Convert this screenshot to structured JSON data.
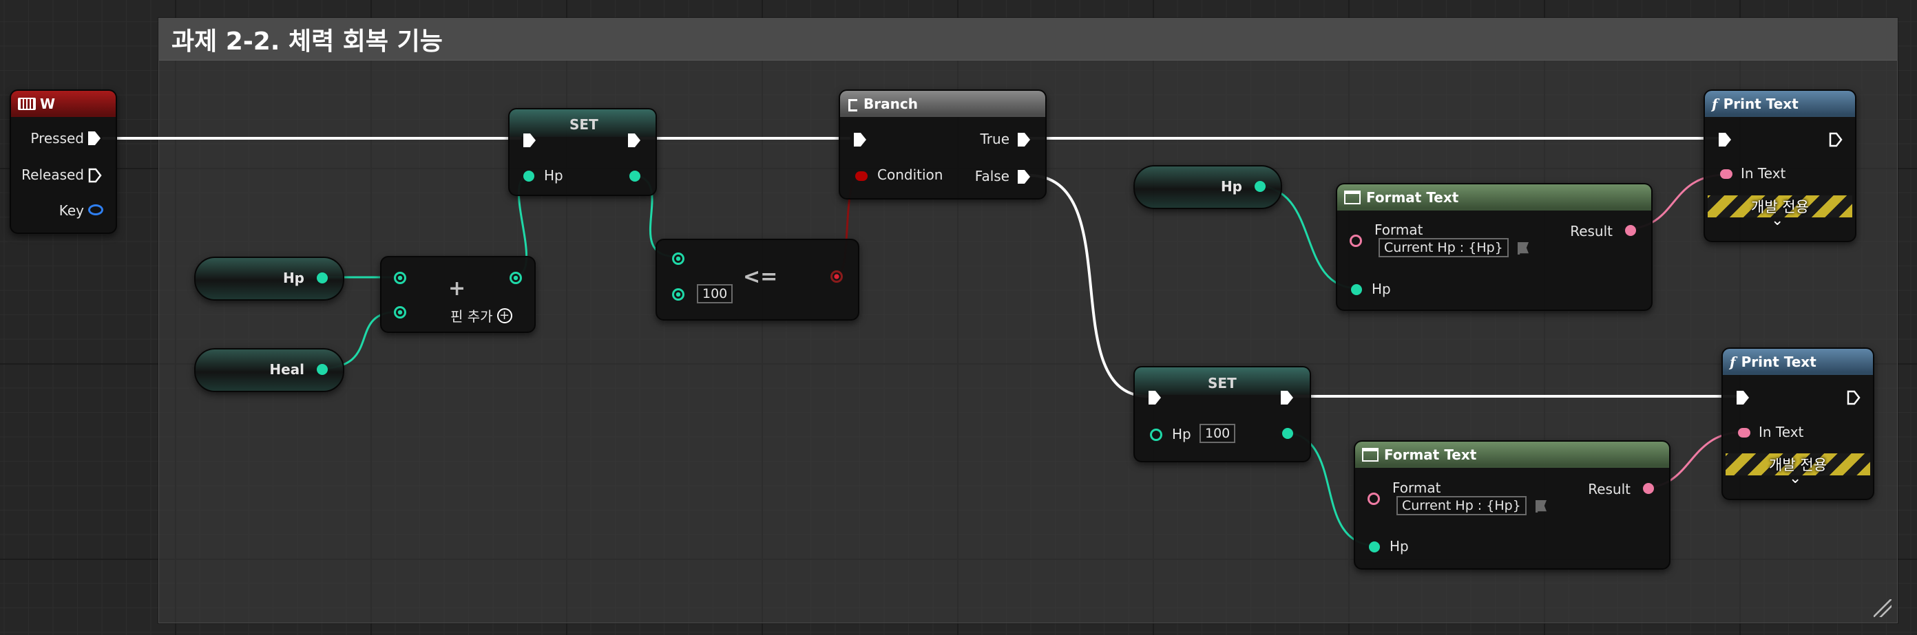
{
  "comment": {
    "title": "과제 2-2. 체력 회복 기능"
  },
  "key_event": {
    "title": "W",
    "pressed": "Pressed",
    "released": "Released",
    "key": "Key"
  },
  "var_hp_1": {
    "label": "Hp"
  },
  "var_heal": {
    "label": "Heal"
  },
  "add_node": {
    "symbol": "+",
    "add_pin": "핀 추가",
    "add_icon": "+"
  },
  "set_1": {
    "title": "SET",
    "pin": "Hp"
  },
  "compare": {
    "symbol": "<=",
    "value": "100"
  },
  "branch": {
    "title": "Branch",
    "condition": "Condition",
    "true_label": "True",
    "false_label": "False"
  },
  "var_hp_2": {
    "label": "Hp"
  },
  "format_1": {
    "title": "Format Text",
    "format_label": "Format",
    "format_value": "Current Hp : {Hp}",
    "result": "Result",
    "hp": "Hp"
  },
  "print_1": {
    "title": "Print Text",
    "in_text": "In Text",
    "dev_only": "개발 전용",
    "chevron": "⌄"
  },
  "set_2": {
    "title": "SET",
    "pin": "Hp",
    "value": "100"
  },
  "format_2": {
    "title": "Format Text",
    "format_label": "Format",
    "format_value": "Current Hp : {Hp}",
    "result": "Result",
    "hp": "Hp"
  },
  "print_2": {
    "title": "Print Text",
    "in_text": "In Text",
    "dev_only": "개발 전용",
    "chevron": "⌄"
  },
  "colors": {
    "exec": "#ffffff",
    "integer": "#1fd9a8",
    "text": "#ef7ba3",
    "boolean": "#b40000",
    "struct": "#2f7ff0"
  }
}
